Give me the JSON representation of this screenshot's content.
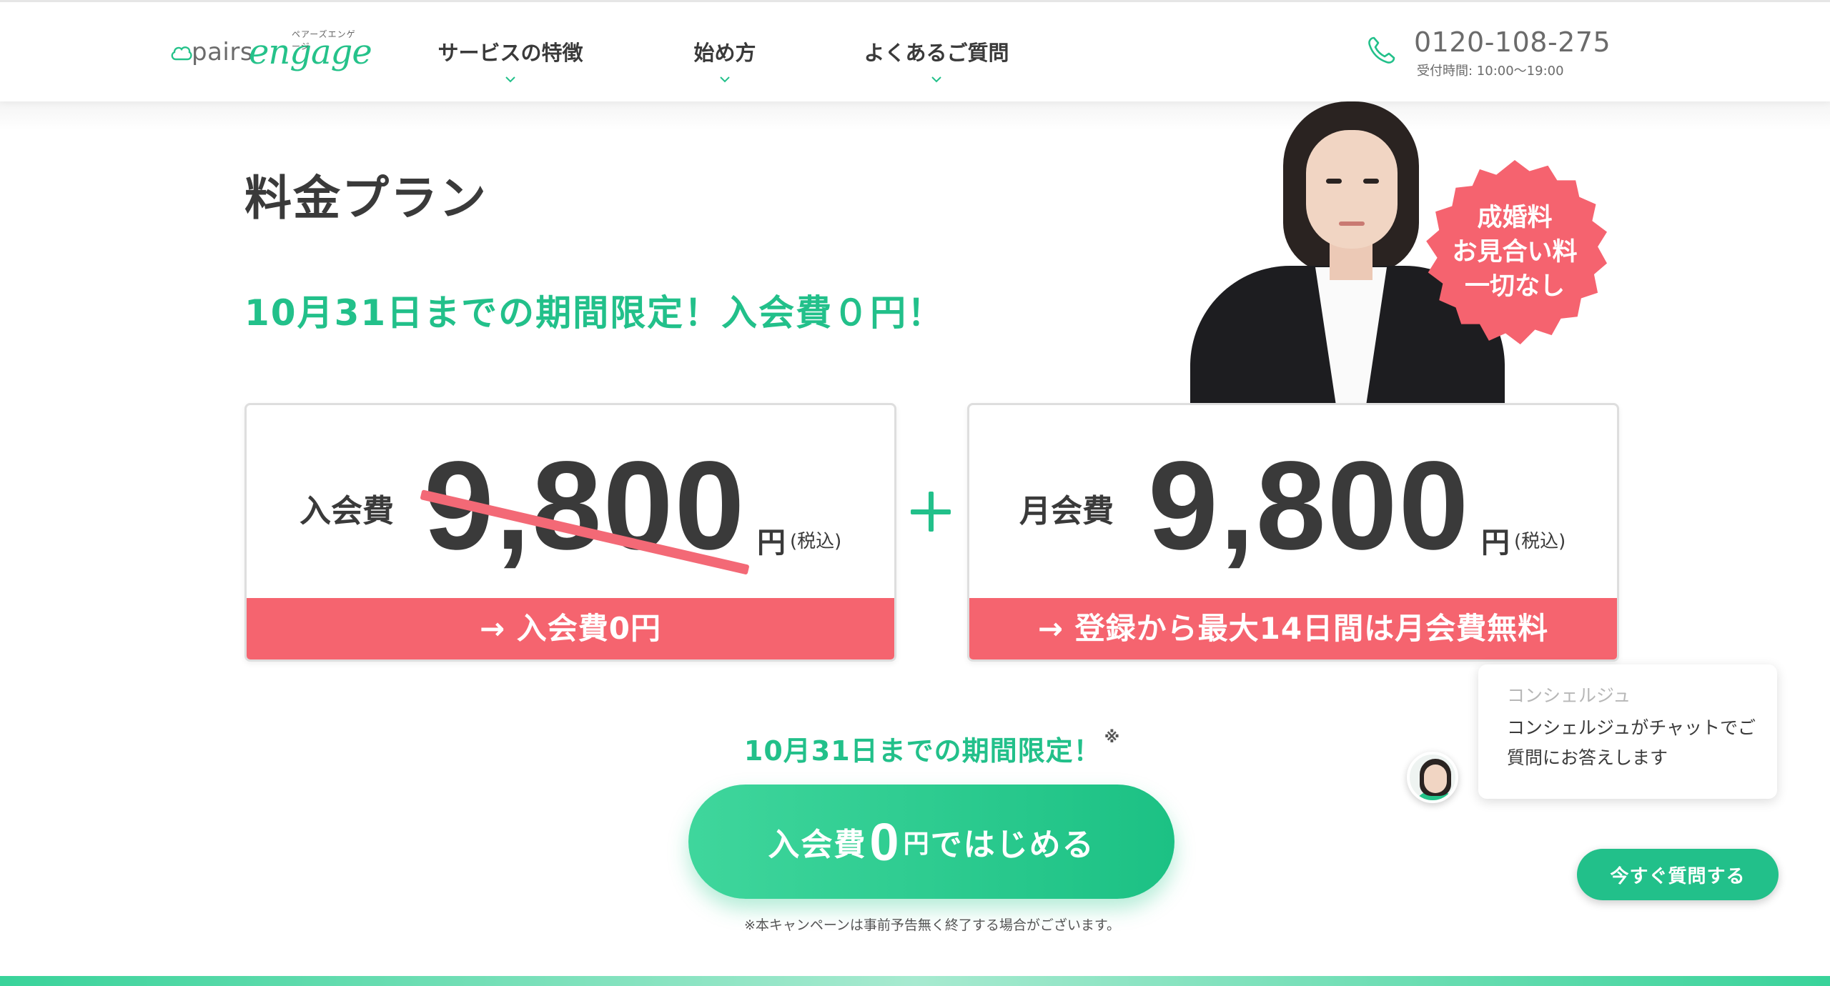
{
  "header": {
    "logo": {
      "pairs": "pairs",
      "engage": "engage",
      "ruby": "ペアーズエンゲージ"
    },
    "nav": [
      {
        "label": "サービスの特徴"
      },
      {
        "label": "始め方"
      },
      {
        "label": "よくあるご質問"
      }
    ],
    "phone": {
      "number": "0120-108-275",
      "hours": "受付時間: 10:00〜19:00"
    }
  },
  "hero": {
    "title": "料金プラン",
    "campaign": "10月31日までの期間限定！入会費０円！",
    "badge": [
      "成婚料",
      "お見合い料",
      "一切なし"
    ]
  },
  "plans": {
    "entry": {
      "label": "入会費",
      "price": "9,800",
      "unit": "円",
      "tax": "(税込)",
      "footer": "→ 入会費0円"
    },
    "monthly": {
      "label": "月会費",
      "price": "9,800",
      "unit": "円",
      "tax": "(税込)",
      "footer": "→ 登録から最大14日間は月会費無料"
    }
  },
  "cta": {
    "note": "10月31日までの期間限定！",
    "note_mark": "※",
    "button": {
      "pre": "入会費",
      "zero": "0",
      "mid": "円",
      "post": "ではじめる"
    },
    "disclaimer": "※本キャンペーンは事前予告無く終了する場合がございます。"
  },
  "chat": {
    "who": "コンシェルジュ",
    "message": "コンシェルジュがチャットでご質問にお答えします",
    "button": "今すぐ質問する"
  },
  "colors": {
    "accent_green": "#22c08a",
    "accent_red": "#f5646f",
    "text_dark": "#3a3a3a"
  },
  "icons": [
    "cloud-logo-icon",
    "chevron-down-icon",
    "phone-icon",
    "plus-icon"
  ]
}
